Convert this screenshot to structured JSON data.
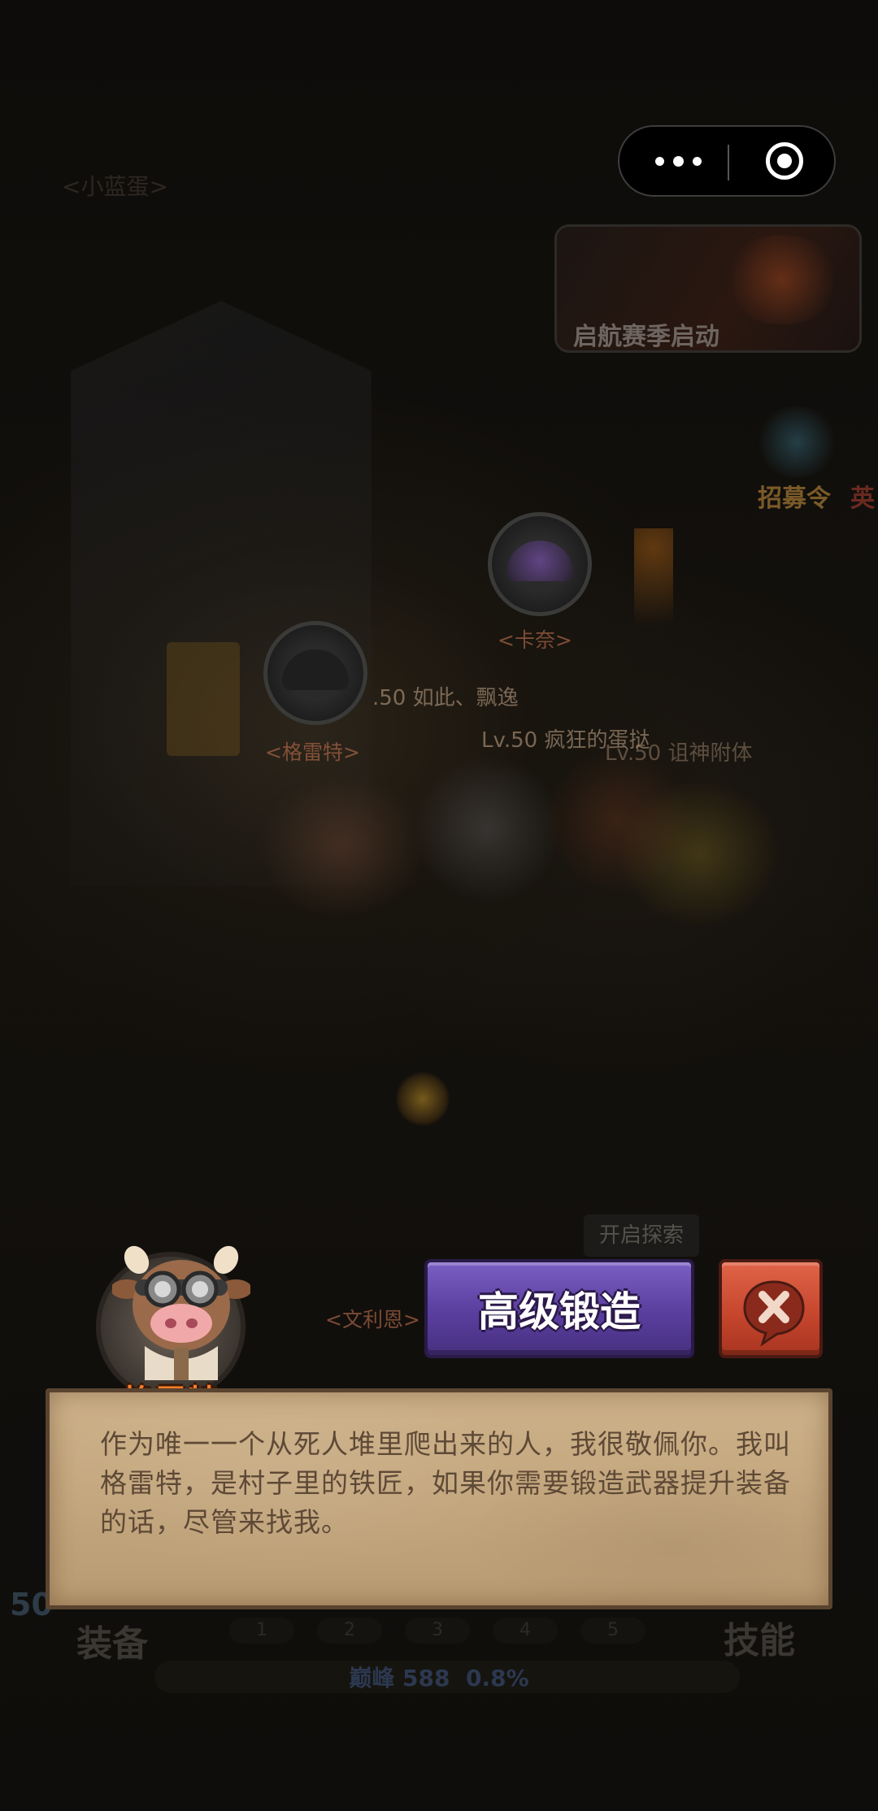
{
  "capsule": {
    "more_icon": "more-dots-icon",
    "close_icon": "target-circle-icon"
  },
  "event_banner": {
    "label": "启航赛季启动"
  },
  "recruit": {
    "label": "招募令",
    "extra": "英"
  },
  "world": {
    "top_left_faint": "<小蓝蛋>",
    "npc_kana": "<卡奈>",
    "npc_grey": "<格雷特>",
    "npc_wenli": "<文利恩>",
    "player1": ".50 如此、飘逸",
    "player2": "Lv.50 疯狂的蛋挞",
    "player3": "Lv.50 诅神附体",
    "explore_tag": "开启探索"
  },
  "hud": {
    "equipment": "装备",
    "skills": "技能",
    "slots": [
      "1",
      "2",
      "3",
      "4",
      "5"
    ],
    "exp_label": "巅峰 588",
    "exp_percent": "0.8%",
    "level_chip": "50"
  },
  "dialog": {
    "npc_name": "格雷特",
    "forge_button": "高级锻造",
    "text": "作为唯一一个从死人堆里爬出来的人，我很敬佩你。我叫格雷特，是村子里的铁匠，如果你需要锻造武器提升装备的话，尽管来找我。"
  },
  "colors": {
    "forge_button": "#5a3e9e",
    "close_button": "#c4442c",
    "npc_name": "#ff7d28",
    "parchment": "#c3a67d",
    "dialog_text": "#5e4936"
  }
}
